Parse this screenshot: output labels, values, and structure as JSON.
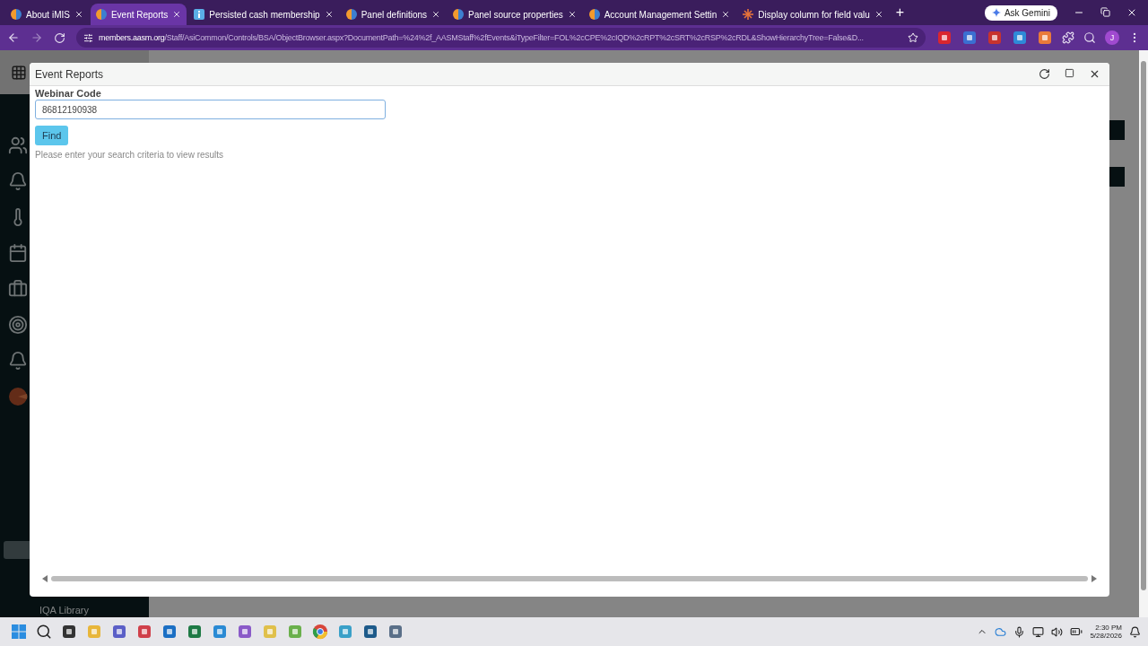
{
  "browser": {
    "tabs": [
      {
        "title": "About iMIS",
        "kind": "imis",
        "selected": false
      },
      {
        "title": "Event Reports",
        "kind": "imis",
        "selected": true
      },
      {
        "title": "Persisted cash membership",
        "kind": "info",
        "selected": false
      },
      {
        "title": "Panel definitions",
        "kind": "imis",
        "selected": false
      },
      {
        "title": "Panel source properties",
        "kind": "imis",
        "selected": false
      },
      {
        "title": "Account Management Settin",
        "kind": "imis",
        "selected": false
      },
      {
        "title": "Display column for field valu",
        "kind": "spark",
        "selected": false
      }
    ],
    "new_tab": "+",
    "ask_gemini": "Ask Gemini",
    "address": {
      "host": "members.aasm.org",
      "path": "/Staff/AsiCommon/Controls/BSA/ObjectBrowser.aspx?DocumentPath=%24%2f_AASMStaff%2fEvents&iTypeFilter=FOL%2cCPE%2cIQD%2cRPT%2cSRT%2cRSP%2cRDL&ShowHierarchyTree=False&D..."
    },
    "profile_initial": "J"
  },
  "app": {
    "sidebar_footer": "IQA Library"
  },
  "dialog": {
    "title": "Event Reports",
    "field": {
      "label": "Webinar Code",
      "value": "86812190938"
    },
    "find_button": "Find",
    "message": "Please enter your search criteria to view results"
  },
  "taskbar": {
    "time": "2:30 PM",
    "date": "5/28/2026"
  }
}
